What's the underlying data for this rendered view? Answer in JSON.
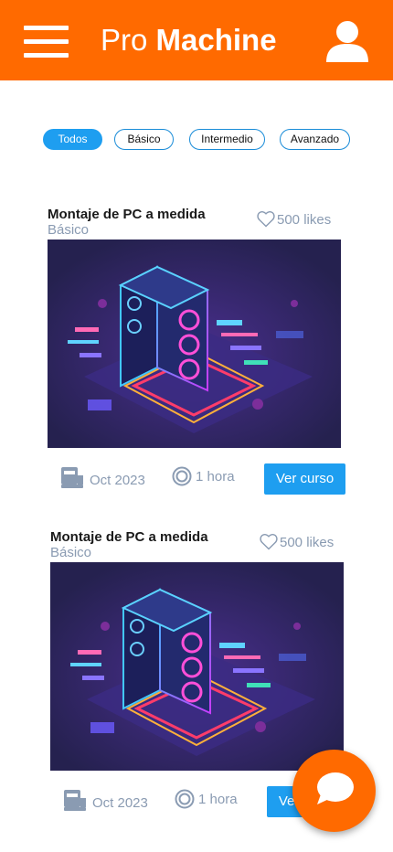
{
  "header": {
    "brand_first": "Pro",
    "brand_second": "Machine",
    "menu_icon": "hamburger-menu-icon",
    "user_icon": "user-profile-icon",
    "background_color": "#ff6a00"
  },
  "filters": [
    {
      "label": "Todos",
      "active": true
    },
    {
      "label": "Básico",
      "active": false
    },
    {
      "label": "Intermedio",
      "active": false
    },
    {
      "label": "Avanzado",
      "active": false
    }
  ],
  "courses": [
    {
      "title": "Montaje de PC a medida",
      "level": "Básico",
      "likes": "500 likes",
      "date": "Oct 2023",
      "duration": "1 hora",
      "button": "Ver curso"
    },
    {
      "title": "Montaje de PC a medida",
      "level": "Básico",
      "likes": "500 likes",
      "date": "Oct 2023",
      "duration": "1 hora",
      "button": "Ver curso"
    }
  ],
  "chat": {
    "icon": "chat-bubble-icon"
  },
  "colors": {
    "accent": "#ff6a00",
    "primary": "#1e9ef0",
    "muted": "#8a9bb2"
  }
}
